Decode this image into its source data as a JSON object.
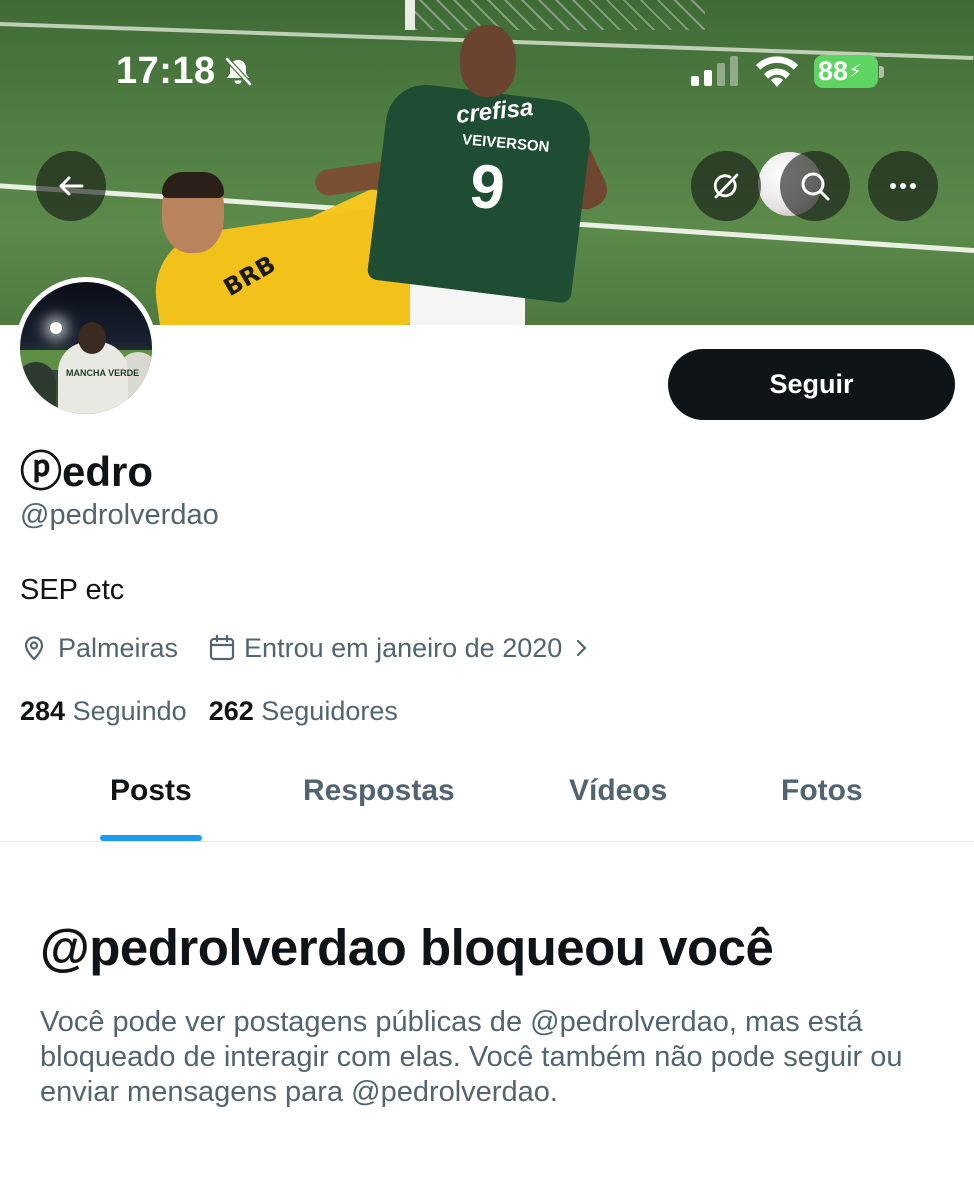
{
  "status_bar": {
    "time": "17:18",
    "battery": "88",
    "icons": [
      "bell-slash-icon",
      "cellular-signal-icon",
      "wifi-icon",
      "battery-charging-icon"
    ]
  },
  "header": {
    "icons": [
      "back-arrow-icon",
      "grok-icon",
      "search-icon",
      "more-icon"
    ],
    "banner_text": {
      "sponsor": "crefisa",
      "shirt_name": "VEIVERSON",
      "shirt_number": "9",
      "keeper_sponsor": "BRB"
    }
  },
  "avatar": {
    "shirt_text": "MANCHA VERDE"
  },
  "profile": {
    "display_name": "ⓟedro",
    "handle": "@pedrolverdao",
    "bio": "SEP etc",
    "location": "Palmeiras",
    "joined": "Entrou em janeiro de 2020",
    "following_count": "284",
    "following_label": "Seguindo",
    "followers_count": "262",
    "followers_label": "Seguidores"
  },
  "actions": {
    "follow_label": "Seguir"
  },
  "tabs": [
    {
      "label": "Posts",
      "active": true
    },
    {
      "label": "Respostas",
      "active": false
    },
    {
      "label": "Vídeos",
      "active": false
    },
    {
      "label": "Fotos",
      "active": false
    }
  ],
  "blocked_notice": {
    "title": "@pedrolverdao bloqueou você",
    "message": "Você pode ver postagens públicas de @pedrolverdao, mas está bloqueado de interagir com elas. Você também não pode seguir ou enviar mensagens para @pedrolverdao."
  },
  "colors": {
    "accent": "#1d9bf0",
    "text_primary": "#0f1419",
    "text_secondary": "#536471",
    "follow_button": "#0f1419",
    "battery": "#5ed462"
  }
}
